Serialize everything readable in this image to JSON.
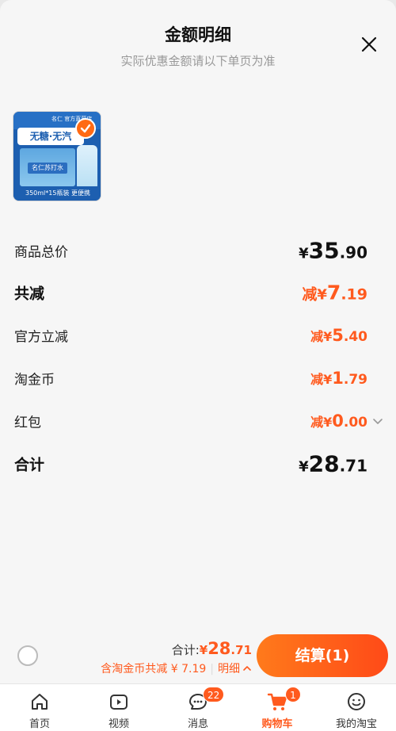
{
  "header": {
    "title": "金额明细",
    "subtitle": "实际优惠金额请以下单页为准",
    "close_icon": "close-icon"
  },
  "product": {
    "brand": "名仁 官方直营店",
    "headline": "无糖·无汽",
    "box_label": "名仁苏打水",
    "caption": "350ml*15瓶装 更便携",
    "selected": true
  },
  "breakdown": {
    "total_price": {
      "label": "商品总价",
      "yen": "¥",
      "int": "35",
      "dec": ".90"
    },
    "total_discount": {
      "label": "共减",
      "prefix": "减",
      "yen": "¥",
      "int": "7",
      "dec": ".19"
    },
    "official_discount": {
      "label": "官方立减",
      "prefix": "减",
      "yen": "¥",
      "int": "5",
      "dec": ".40"
    },
    "taobao_coins": {
      "label": "淘金币",
      "prefix": "减",
      "yen": "¥",
      "int": "1",
      "dec": ".79"
    },
    "red_packet": {
      "label": "红包",
      "prefix": "减",
      "yen": "¥",
      "int": "0",
      "dec": ".00"
    },
    "grand_total": {
      "label": "合计",
      "yen": "¥",
      "int": "28",
      "dec": ".71"
    }
  },
  "checkout": {
    "sum_label": "合计:",
    "sum_yen": "¥",
    "sum_int": "28",
    "sum_dec": ".71",
    "discount_text": "含淘金币共减 ¥ 7.19",
    "detail_link": "明细",
    "pay_button": "结算(1)"
  },
  "tabbar": [
    {
      "label": "首页",
      "icon": "home-icon"
    },
    {
      "label": "视频",
      "icon": "video-icon"
    },
    {
      "label": "消息",
      "icon": "message-icon",
      "badge": "22"
    },
    {
      "label": "购物车",
      "icon": "cart-icon",
      "badge": "1",
      "active": true
    },
    {
      "label": "我的淘宝",
      "icon": "profile-icon"
    }
  ],
  "colors": {
    "accent": "#ff5a1e",
    "text": "#111111",
    "muted": "#999999",
    "background": "#f6f6f6"
  }
}
